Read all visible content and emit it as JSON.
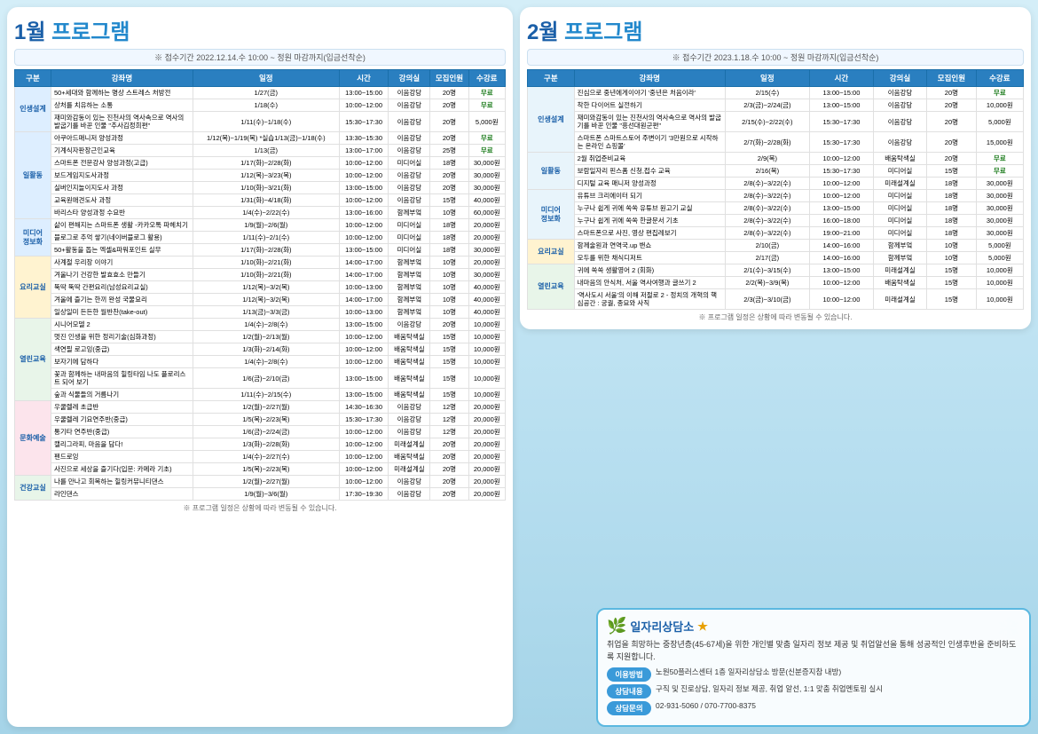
{
  "left_panel": {
    "title_month": "1월",
    "title_prog": "프로그램",
    "notice": "※ 접수기간 2022.12.14.수 10:00 ~ 정원 마감까지(입금선착순)",
    "table_headers": [
      "구분",
      "강좌명",
      "일정",
      "시간",
      "강의실",
      "모집인원",
      "수강료"
    ],
    "sections": [
      {
        "category": "인생설계",
        "rows": [
          [
            "50+세대와 함께하는 명상 스트레스 처방전",
            "1/27(금)",
            "13:00~15:00",
            "이음강당",
            "20명",
            "무료"
          ],
          [
            "상처를 치유하는 소통",
            "1/18(수)",
            "10:00~12:00",
            "이음강당",
            "20명",
            "무료"
          ],
          [
            "재미와감동이 있는 진천사의 역사속으로 역사의 발굽기를 바꾼 인물 \"추사김정희편\"",
            "1/11(수)~1/18(수)",
            "15:30~17:30",
            "이음강당",
            "20명",
            "5,000원"
          ]
        ]
      },
      {
        "category": "일활동",
        "rows": [
          [
            "아쿠아드매니저 양성과정",
            "1/12(목)~1/19(목) *실습1/13(금)~1/18(수)",
            "13:30~15:30",
            "이음강당",
            "20명",
            "무료"
          ],
          [
            "기계식자판장근인교육",
            "1/13(금)",
            "13:00~17:00",
            "이음강당",
            "25명",
            "무료"
          ],
          [
            "스마트폰 전문강사 양성과정(고급)",
            "1/17(화)~2/28(화)",
            "10:00~12:00",
            "미디어실",
            "18명",
            "30,000원"
          ],
          [
            "보드게임지도사과정",
            "1/12(목)~3/23(목)",
            "10:00~12:00",
            "이음강당",
            "20명",
            "30,000원"
          ],
          [
            "실버인지놀이지도사 과정",
            "1/10(화)~3/21(화)",
            "13:00~15:00",
            "이음강당",
            "20명",
            "30,000원"
          ],
          [
            "교육원애견도사 과정",
            "1/31(화)~4/18(화)",
            "10:00~12:00",
            "이음강당",
            "15명",
            "40,000원"
          ],
          [
            "바리스타 양성과정 수요반",
            "1/4(수)~2/22(수)",
            "13:00~16:00",
            "함께부엌",
            "10명",
            "60,000원"
          ]
        ]
      },
      {
        "category": "미디어\n정보화",
        "rows": [
          [
            "삶이 편해지는 스마트폰 생활 -카카오톡 파헤치기",
            "1/9(월)~2/6(월)",
            "10:00~12:00",
            "미디어실",
            "18명",
            "20,000원"
          ],
          [
            "블로그로 추억 쌓기(네이버블로그 활용)",
            "1/11(수)~2/1(수)",
            "10:00~12:00",
            "미디어실",
            "18명",
            "20,000원"
          ],
          [
            "50+활동을 돕는 엑셀&파워포인트 실무",
            "1/17(화)~2/28(화)",
            "13:00~15:00",
            "미디어실",
            "18명",
            "30,000원"
          ]
        ]
      },
      {
        "category": "요리교실",
        "rows": [
          [
            "사계절 우리장 이야기",
            "1/10(화)~2/21(화)",
            "14:00~17:00",
            "함께부엌",
            "10명",
            "20,000원"
          ],
          [
            "겨울나기 건강한 발효효소 만들기",
            "1/10(화)~2/21(화)",
            "14:00~17:00",
            "함께부엌",
            "10명",
            "30,000원"
          ],
          [
            "뚝딱 뚝딱 간편요리(남성요리교실)",
            "1/12(목)~3/2(목)",
            "10:00~13:00",
            "함께부엌",
            "10명",
            "40,000원"
          ],
          [
            "겨울에 즐기는 한끼 완성 국물요리",
            "1/12(목)~3/2(목)",
            "14:00~17:00",
            "함께부엌",
            "10명",
            "40,000원"
          ],
          [
            "일상일미 든든한 월반찬(take-out)",
            "1/13(금)~3/3(금)",
            "10:00~13:00",
            "함께부엌",
            "10명",
            "40,000원"
          ]
        ]
      },
      {
        "category": "열린교육",
        "rows": [
          [
            "시니어모델 2",
            "1/4(수)~2/8(수)",
            "13:00~15:00",
            "이음강당",
            "20명",
            "10,000원"
          ],
          [
            "멋진 인생을 위한 정리기술(심화과정)",
            "1/2(월)~2/13(월)",
            "10:00~12:00",
            "배움탁색실",
            "15명",
            "10,000원"
          ],
          [
            "색연필 로고잉(중급)",
            "1/3(화)~2/14(화)",
            "10:00~12:00",
            "배움탁색실",
            "15명",
            "10,000원"
          ],
          [
            "보자기에 담하다",
            "1/4(수)~2/8(수)",
            "10:00~12:00",
            "배움탁색실",
            "15명",
            "10,000원"
          ],
          [
            "꽃과 함께하는 내마음의 힐링타임 나도 플로리스트 되어 보기",
            "1/6(금)~2/10(금)",
            "13:00~15:00",
            "배움탁색실",
            "15명",
            "10,000원"
          ],
          [
            "숲과 식물들의 거름나기",
            "1/11(수)~2/15(수)",
            "13:00~15:00",
            "배움탁색실",
            "15명",
            "10,000원"
          ]
        ]
      },
      {
        "category": "문화예술",
        "rows": [
          [
            "우쿨렐레 초급반",
            "1/2(월)~2/27(월)",
            "14:30~16:30",
            "이음강당",
            "12명",
            "20,000원"
          ],
          [
            "우쿨렐레 기요연주반(중급)",
            "1/5(목)~2/23(목)",
            "15:30~17:30",
            "이음강당",
            "12명",
            "20,000원"
          ],
          [
            "통기타 연주반(중급)",
            "1/6(금)~2/24(금)",
            "10:00~12:00",
            "이음강당",
            "12명",
            "20,000원"
          ],
          [
            "캘리그라피, 마음을 담다!",
            "1/3(화)~2/28(화)",
            "10:00~12:00",
            "미래설계실",
            "20명",
            "20,000원"
          ],
          [
            "펜드로잉",
            "1/4(수)~2/27(수)",
            "10:00~12:00",
            "배움탁색실",
            "20명",
            "20,000원"
          ],
          [
            "사진으로 세상을 즐기다(입문: 카메라 기초)",
            "1/5(목)~2/23(목)",
            "10:00~12:00",
            "미래설계실",
            "20명",
            "20,000원"
          ]
        ]
      },
      {
        "category": "건강교실",
        "rows": [
          [
            "나를 만나고 회복하는 힐링커뮤니티댄스",
            "1/2(월)~2/27(월)",
            "10:00~12:00",
            "이음강당",
            "20명",
            "20,000원"
          ],
          [
            "라인댄스",
            "1/9(월)~3/6(월)",
            "17:30~19:30",
            "이음강당",
            "20명",
            "20,000원"
          ]
        ]
      }
    ],
    "footnote": "※ 프로그램 일정은 상황에 따라 변동될 수 있습니다."
  },
  "right_panel": {
    "title_month": "2월",
    "title_prog": "프로그램",
    "notice": "※ 접수기간 2023.1.18.수 10:00 ~ 정원 마감까지(입금선착순)",
    "table_headers": [
      "구분",
      "강좌명",
      "일정",
      "시간",
      "강의실",
      "모집인원",
      "수강료"
    ],
    "sections": [
      {
        "category": "인생설계",
        "rows": [
          [
            "진심으로 중년에게이야기 '중년은 처음이라'",
            "2/15(수)",
            "13:00~15:00",
            "이음강당",
            "20명",
            "무료"
          ],
          [
            "착한 다이어트 실전하기",
            "2/3(금)~2/24(금)",
            "13:00~15:00",
            "이음강당",
            "20명",
            "10,000원"
          ],
          [
            "재미와감동이 있는 진천사의 역사속으로 역사의 발굽기를 바꾼 인물 \"흥선대원군편\"",
            "2/15(수)~2/22(수)",
            "15:30~17:30",
            "이음강당",
            "20명",
            "5,000원"
          ],
          [
            "스마트폰 스마트스토어 주변이기 '3만원으로 시작하는 온라인 쇼핑몰'",
            "2/7(화)~2/28(화)",
            "15:30~17:30",
            "이음강당",
            "20명",
            "15,000원"
          ]
        ]
      },
      {
        "category": "일활동",
        "rows": [
          [
            "2월 취업준비교육",
            "2/9(목)",
            "10:00~12:00",
            "배움탁색실",
            "20명",
            "무료"
          ],
          [
            "보람일자리 핀스폼 신청,접수 교육",
            "2/16(목)",
            "15:30~17:30",
            "미디어실",
            "15명",
            "무료"
          ],
          [
            "디지털 교육 매니저 양성과정",
            "2/8(수)~3/22(수)",
            "10:00~12:00",
            "미래설계실",
            "18명",
            "30,000원"
          ]
        ]
      },
      {
        "category": "미디어\n정보화",
        "rows": [
          [
            "유튜브 크리에이터 되기",
            "2/8(수)~3/22(수)",
            "10:00~12:00",
            "미디어실",
            "18명",
            "30,000원"
          ],
          [
            "누구나 쉽게 귀에 쏙쏙 유튜브 원고기 교실",
            "2/8(수)~3/22(수)",
            "13:00~15:00",
            "미디어실",
            "18명",
            "30,000원"
          ],
          [
            "누구나 쉽게 귀에 쏙쏙 한글문서 기초",
            "2/8(수)~3/22(수)",
            "16:00~18:00",
            "미디어실",
            "18명",
            "30,000원"
          ],
          [
            "스마트폰으로 사진, 영상 편집레보기",
            "2/8(수)~3/22(수)",
            "19:00~21:00",
            "미디어실",
            "18명",
            "30,000원"
          ]
        ]
      },
      {
        "category": "요리교실",
        "rows": [
          [
            "함께술원과 연역국.up 밴쇼",
            "2/10(금)",
            "14:00~16:00",
            "함께부엌",
            "10명",
            "5,000원"
          ],
          [
            "모두를 위한 채식디저트",
            "2/17(금)",
            "14:00~16:00",
            "함께부엌",
            "10명",
            "5,000원"
          ]
        ]
      },
      {
        "category": "열린교육",
        "rows": [
          [
            "귀에 쏙쏙 생활영어 2 (회화)",
            "2/1(수)~3/15(수)",
            "13:00~15:00",
            "미래설계실",
            "15명",
            "10,000원"
          ],
          [
            "내마음의 안식처, 서울 역사여행과 글쓰기 2",
            "2/2(목)~3/9(목)",
            "10:00~12:00",
            "배움탁색실",
            "15명",
            "10,000원"
          ],
          [
            "'역사도시 서울'의 이해 저절로 2 - 정치의 개혁의 핵심공간 : 궁궐, 종묘와 사직",
            "2/3(금)~3/10(금)",
            "10:00~12:00",
            "미래설계실",
            "15명",
            "10,000원"
          ]
        ]
      }
    ],
    "footnote": "※ 프로그램 일정은 상황에 따라 변동될 수 있습니다.",
    "consultation": {
      "title": "일자리상담소",
      "star": "★",
      "desc": "취업을 희망하는 중장년층(45-67세)을 위한 개인별 맞춤 일자리 정보 제공 및 취업알선을 통해 성공적인 인생후반을 준비하도록 지원합니다.",
      "items": [
        {
          "label": "이용방법",
          "content": "노원50플러스센터 1층 일자리상담소 방문(신분증지참 내방)"
        },
        {
          "label": "상담내용",
          "content": "구직 및 진로상담, 일자리 정보 제공, 취업 알선, 1:1 맞춤 취업멘토링 실시"
        },
        {
          "label": "상담문의",
          "content": "02-931-5060 / 070-7700-8375"
        }
      ]
    }
  }
}
